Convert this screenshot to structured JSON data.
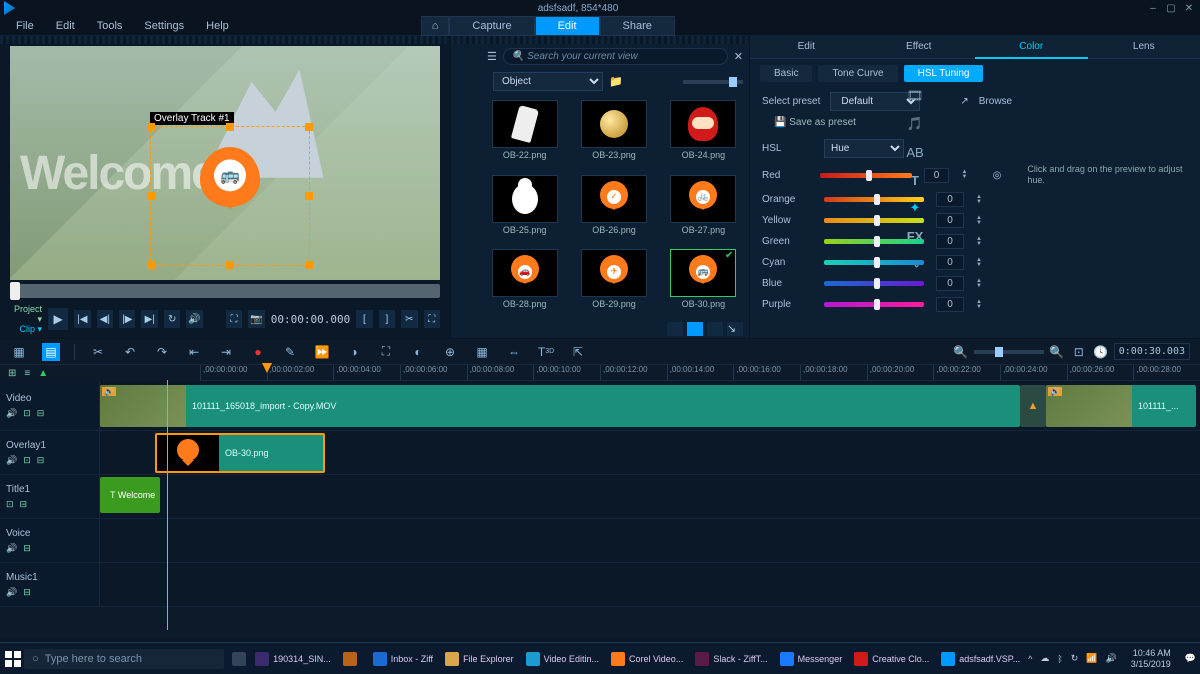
{
  "window": {
    "res_badge": "adsfsadf, 854*480"
  },
  "menu": {
    "items": [
      "File",
      "Edit",
      "Tools",
      "Settings",
      "Help"
    ]
  },
  "modes": {
    "home": "⌂",
    "tabs": [
      "Capture",
      "Edit",
      "Share"
    ],
    "active": 1
  },
  "preview": {
    "overlay_label": "Overlay Track #1",
    "pin_icon": "🚌",
    "watermark": "Welcome",
    "project_label": "Project ▾",
    "clip_label": "Clip ▾",
    "timecode": "00:00:00.000"
  },
  "library": {
    "search_placeholder": "Search your current view",
    "category": "Object",
    "items": [
      {
        "cap": "OB-22.png",
        "kind": "tag"
      },
      {
        "cap": "OB-23.png",
        "kind": "moon"
      },
      {
        "cap": "OB-24.png",
        "kind": "santa"
      },
      {
        "cap": "OB-25.png",
        "kind": "snow"
      },
      {
        "cap": "OB-26.png",
        "kind": "pin",
        "glyph": "✓"
      },
      {
        "cap": "OB-27.png",
        "kind": "pin",
        "glyph": "🚲"
      },
      {
        "cap": "OB-28.png",
        "kind": "pin",
        "glyph": "🚗"
      },
      {
        "cap": "OB-29.png",
        "kind": "pin",
        "glyph": "✈"
      },
      {
        "cap": "OB-30.png",
        "kind": "pin",
        "glyph": "🚌",
        "sel": true
      }
    ]
  },
  "effects": {
    "tabs": [
      "Edit",
      "Effect",
      "Color",
      "Lens"
    ],
    "active": 2,
    "sub": [
      "Basic",
      "Tone Curve",
      "HSL Tuning"
    ],
    "sub_active": 2,
    "preset_label": "Select preset",
    "preset_value": "Default",
    "browse": "Browse",
    "save": "Save as preset",
    "hsl_label": "HSL",
    "hsl_mode": "Hue",
    "channels": [
      {
        "name": "Red",
        "grad": [
          "#c71c1c",
          "#ff7a1a"
        ],
        "val": 0
      },
      {
        "name": "Orange",
        "grad": [
          "#d23b1a",
          "#ffd21a"
        ],
        "val": 0
      },
      {
        "name": "Yellow",
        "grad": [
          "#f08a1a",
          "#c7e01a"
        ],
        "val": 0
      },
      {
        "name": "Green",
        "grad": [
          "#9ad11a",
          "#1ad190"
        ],
        "val": 0
      },
      {
        "name": "Cyan",
        "grad": [
          "#1ad1b5",
          "#1a8ad1"
        ],
        "val": 0
      },
      {
        "name": "Blue",
        "grad": [
          "#1a6ad1",
          "#6a1ad1"
        ],
        "val": 0
      },
      {
        "name": "Purple",
        "grad": [
          "#b01ad1",
          "#ff1a9b"
        ],
        "val": 0
      }
    ],
    "hint": "Click and drag on the preview to adjust hue."
  },
  "timeline": {
    "duration_tc": "0:00:30.003",
    "marks": [
      ",00:00:00:00",
      ",00:00:02:00",
      ",00:00:04:00",
      ",00:00:06:00",
      ",00:00:08:00",
      ",00:00:10:00",
      ",00:00:12:00",
      ",00:00:14:00",
      ",00:00:16:00",
      ",00:00:18:00",
      ",00:00:20:00",
      ",00:00:22:00",
      ",00:00:24:00",
      ",00:00:26:00",
      ",00:00:28:00"
    ],
    "tracks": [
      {
        "name": "Video"
      },
      {
        "name": "Overlay1"
      },
      {
        "name": "Title1"
      },
      {
        "name": "Voice"
      },
      {
        "name": "Music1"
      }
    ],
    "video_clip": "101111_165018_import - Copy.MOV",
    "video_clip2": "101111_...",
    "overlay_clip": "OB-30.png",
    "title_clip": "Welcome"
  },
  "taskbar": {
    "search": "Type here to search",
    "tasks": [
      {
        "label": "190314_SIN...",
        "color": "#3b2a6e"
      },
      {
        "label": "",
        "color": "#b8621a"
      },
      {
        "label": "Inbox - Ziff",
        "color": "#1a6ad1"
      },
      {
        "label": "File Explorer",
        "color": "#d9a54a"
      },
      {
        "label": "Video Editin...",
        "color": "#1a9bd1"
      },
      {
        "label": "Corel Video...",
        "color": "#ff7a1a"
      },
      {
        "label": "Slack - ZiffT...",
        "color": "#5a1a4a"
      },
      {
        "label": "Messenger",
        "color": "#1a7aff"
      },
      {
        "label": "Creative Clo...",
        "color": "#d11a1a"
      },
      {
        "label": "adsfsadf.VSP...",
        "color": "#0099ff"
      }
    ],
    "time": "10:46 AM",
    "date": "3/15/2019"
  }
}
